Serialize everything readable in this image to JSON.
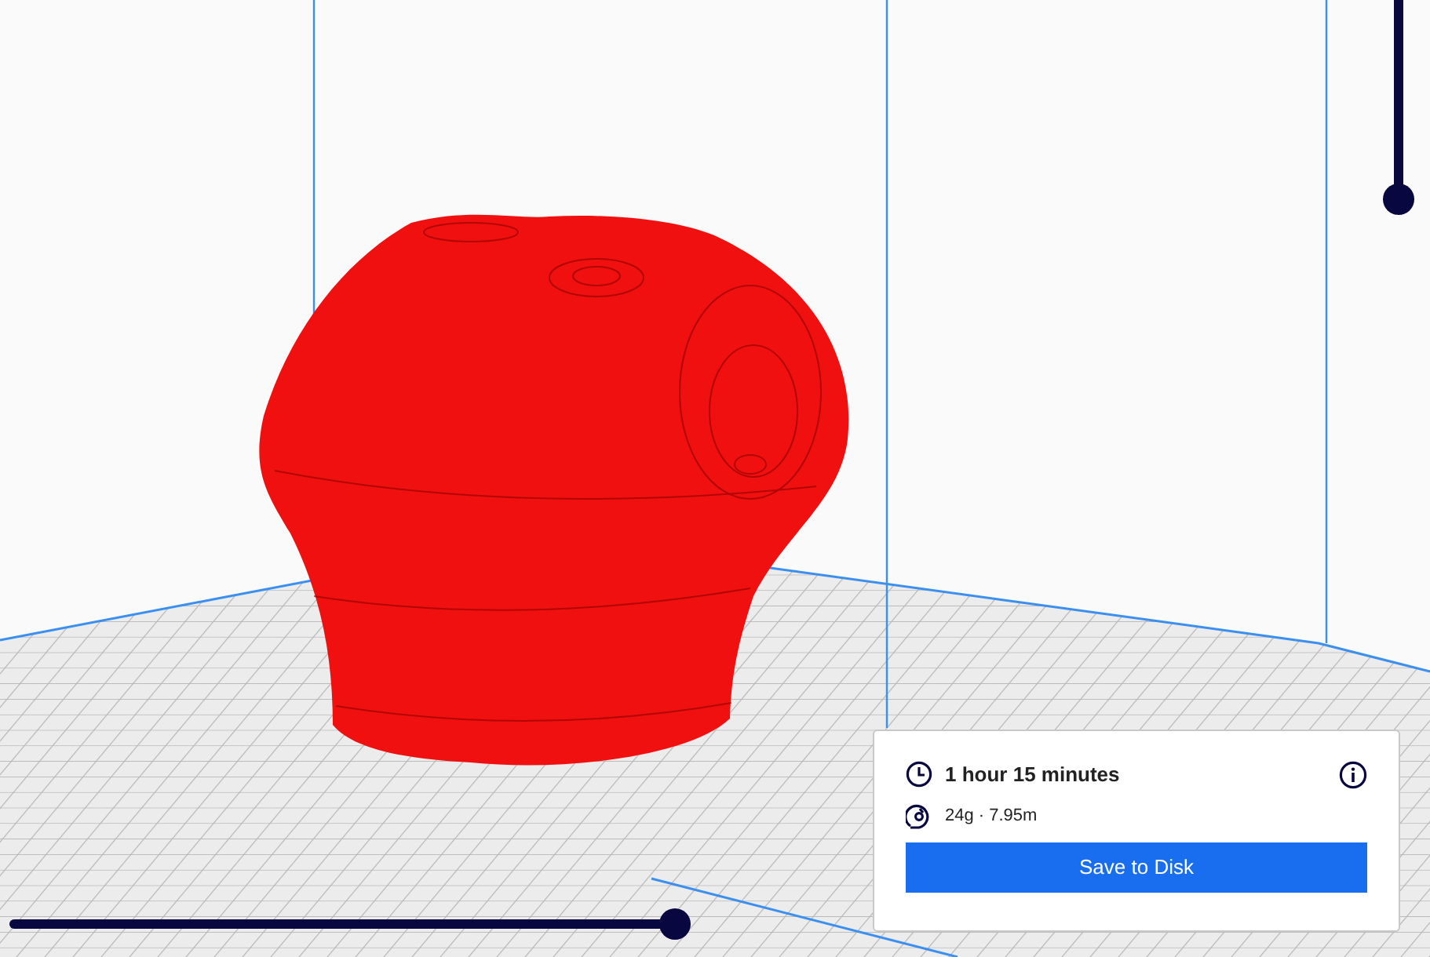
{
  "print_info": {
    "time": "1 hour 15 minutes",
    "material": "24g · 7.95m",
    "save_button": "Save to Disk"
  },
  "layer_slider": {
    "level": 1
  },
  "path_slider": {
    "level": 1
  }
}
